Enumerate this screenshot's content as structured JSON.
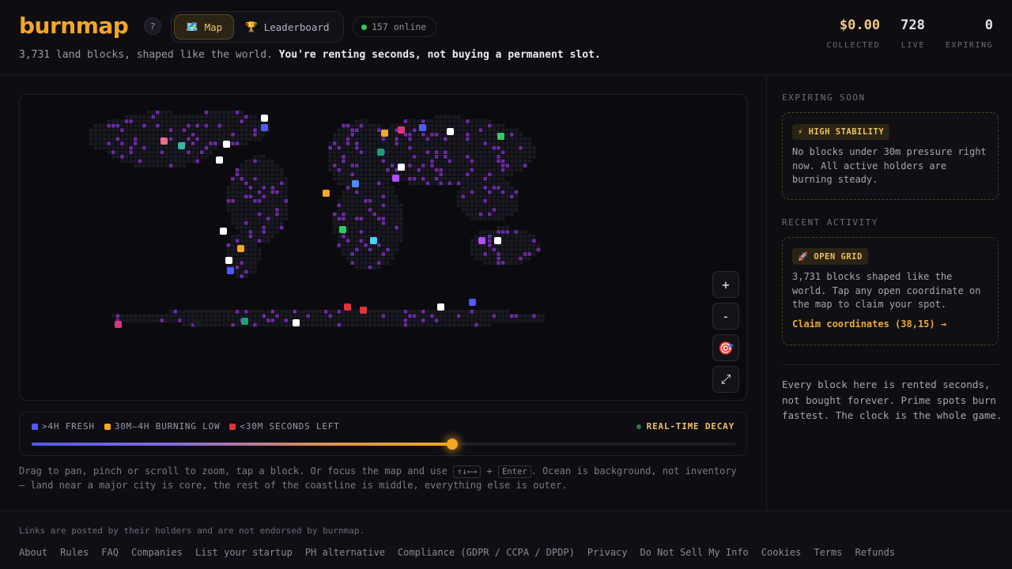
{
  "brand": {
    "logo": "burnmap",
    "help": "?"
  },
  "nav": {
    "tabs": [
      {
        "icon": "🗺️",
        "label": "Map",
        "active": true
      },
      {
        "icon": "🏆",
        "label": "Leaderboard",
        "active": false
      }
    ],
    "online": "157 online"
  },
  "tagline": {
    "prefix": "3,731 land blocks, shaped like the world.",
    "emphasis": "You're renting seconds, not buying a permanent slot."
  },
  "stats": [
    {
      "value": "$0.00",
      "label": "COLLECTED"
    },
    {
      "value": "728",
      "label": "LIVE"
    },
    {
      "value": "0",
      "label": "EXPIRING"
    }
  ],
  "map": {
    "zoom_in": "+",
    "zoom_out": "-",
    "locate_icon": "🎯",
    "fullscreen_icon": "⤢",
    "block_colors": {
      "fresh": "#4f5bff",
      "low": "#f5a623",
      "critical": "#e0343c",
      "claimed": "#6a2c9e",
      "land": "#1a1a22"
    }
  },
  "legend": {
    "items": [
      {
        "label": ">4H FRESH",
        "color": "#4f5bff"
      },
      {
        "label": "30M–4H BURNING LOW",
        "color": "#f5a623"
      },
      {
        "label": "<30M SECONDS LEFT",
        "color": "#e0343c"
      }
    ],
    "realtime": "REAL-TIME DECAY",
    "decay_progress": 0.597
  },
  "help": {
    "line1_a": "Drag to pan, pinch or scroll to zoom, tap a block. Or focus the map and use ",
    "key_arrows": "↑↓←→",
    "plus": " + ",
    "key_enter": "Enter",
    "line1_b": ". Ocean is background, not inventory",
    "line2": "— land near a major city is core, the rest of the coastline is middle, everything else is outer."
  },
  "sidebar": {
    "expiring_title": "EXPIRING SOON",
    "expiring_badge": "⚡ HIGH STABILITY",
    "expiring_text": "No blocks under 30m pressure right now. All active holders are burning steady.",
    "activity_title": "RECENT ACTIVITY",
    "activity_badge": "🚀 OPEN GRID",
    "activity_text": "3,731 blocks shaped like the world. Tap any open coordinate on the map to claim your spot.",
    "claim_link": "Claim coordinates (38,15) →",
    "note": "Every block here is rented seconds, not bought forever. Prime spots burn fastest. The clock is the whole game."
  },
  "footer": {
    "disclaimer": "Links are posted by their holders and are not endorsed by burnmap.",
    "links": [
      "About",
      "Rules",
      "FAQ",
      "Companies",
      "List your startup",
      "PH alternative",
      "Compliance (GDPR / CCPA / DPDP)",
      "Privacy",
      "Do Not Sell My Info",
      "Cookies",
      "Terms",
      "Refunds"
    ]
  }
}
